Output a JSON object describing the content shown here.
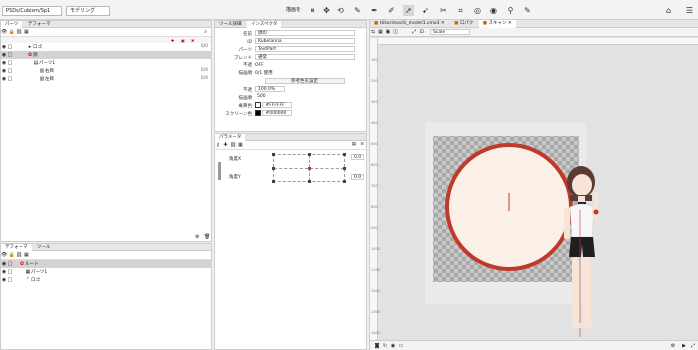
{
  "top_toolbar": {
    "project_select": "PSDs/Cubism/Sp1",
    "mode_select": "モデリング",
    "tool_select_label": "描画をほかにも"
  },
  "left_panel": {
    "tabs": [
      "パーツ",
      "デフォーマ"
    ],
    "tree": [
      {
        "label": "ロゴ",
        "count": "0/0",
        "indent": 1,
        "selected": false
      },
      {
        "label": "顔",
        "count": "",
        "indent": 1,
        "selected": true
      },
      {
        "label": "パーツ1",
        "count": "",
        "indent": 2,
        "selected": false
      },
      {
        "label": "右目",
        "count": "0/4",
        "indent": 3,
        "selected": false
      },
      {
        "label": "左目",
        "count": "0/4",
        "indent": 3,
        "selected": false
      }
    ]
  },
  "left_bottom_panel": {
    "tabs": [
      "デフォーマ",
      "ツール"
    ],
    "tree": [
      {
        "label": "ルート",
        "indent": 1,
        "selected": true
      },
      {
        "label": "パーツ1",
        "indent": 2,
        "selected": false
      },
      {
        "label": "ロゴ",
        "indent": 2,
        "selected": false
      }
    ]
  },
  "inspector": {
    "tabs": [
      "ツール詳細",
      "インスペクタ"
    ],
    "props": [
      {
        "label": "名前",
        "value": "顔の"
      },
      {
        "label": "ID",
        "value": "Kubelanna"
      },
      {
        "label": "パーツ",
        "value": "TextPart"
      },
      {
        "label": "ブレンド",
        "value": "通常"
      },
      {
        "label": "不透",
        "value": "OFF"
      },
      {
        "label": "描画順",
        "value": "0/1 使用"
      }
    ],
    "multiply_button": "参考色を設定",
    "opacity_label": "不透",
    "opacity_value": "100.0%",
    "color_label": "乗算色",
    "color_value": "#FFFFFF",
    "screen_label": "スクリーン色",
    "screen_value": "#000000",
    "order_label": "描画順",
    "order_value": "500"
  },
  "parameter_panel": {
    "tabs": [
      "パラメータ"
    ],
    "params": [
      {
        "label": "角度X",
        "value": "0.0"
      },
      {
        "label": "角度Y",
        "value": "0.0"
      }
    ]
  },
  "canvas": {
    "tabs": [
      {
        "label": "Hikarimochi_model1.cmo3",
        "active": false
      },
      {
        "label": "口パク",
        "active": false
      },
      {
        "label": "スキャン",
        "active": true
      }
    ],
    "sub_select": "Scale",
    "ruler_marks": [
      "100",
      "200",
      "300",
      "400",
      "500",
      "600",
      "700",
      "800",
      "900",
      "1000",
      "1100",
      "1200",
      "1300",
      "1400"
    ],
    "colors": {
      "circle_outline": "#c0392b",
      "circle_fill": "#fbf0e8",
      "checker_a": "#a8a8a8",
      "checker_b": "#c9c9c9"
    }
  }
}
